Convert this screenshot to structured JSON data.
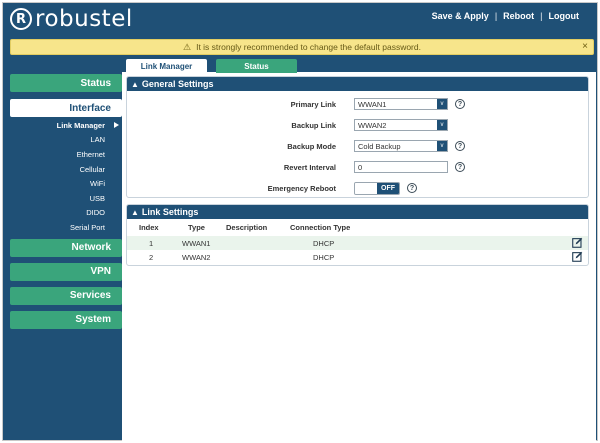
{
  "header": {
    "logo_text": "robustel",
    "logo_mark": "R",
    "links": [
      "Save & Apply",
      "Reboot",
      "Logout"
    ]
  },
  "notice": {
    "icon": "warning-icon",
    "text": "It is strongly recommended to change the default password.",
    "close": "×"
  },
  "sidebar": {
    "status": "Status",
    "interface": "Interface",
    "interface_items": [
      "Link Manager",
      "LAN",
      "Ethernet",
      "Cellular",
      "WiFi",
      "USB",
      "DIDO",
      "Serial Port"
    ],
    "network": "Network",
    "vpn": "VPN",
    "services": "Services",
    "system": "System"
  },
  "tabs": {
    "active": "Link Manager",
    "inactive": "Status"
  },
  "general": {
    "title": "General Settings",
    "primary_link_label": "Primary Link",
    "primary_link_value": "WWAN1",
    "backup_link_label": "Backup Link",
    "backup_link_value": "WWAN2",
    "backup_mode_label": "Backup Mode",
    "backup_mode_value": "Cold Backup",
    "revert_interval_label": "Revert Interval",
    "revert_interval_value": "0",
    "emergency_reboot_label": "Emergency Reboot",
    "emergency_reboot_state": "OFF",
    "arrow": "v",
    "help": "?"
  },
  "link_settings": {
    "title": "Link Settings",
    "headers": [
      "Index",
      "Type",
      "Description",
      "Connection Type"
    ],
    "rows": [
      {
        "index": "1",
        "type": "WWAN1",
        "description": "",
        "connection": "DHCP"
      },
      {
        "index": "2",
        "type": "WWAN2",
        "description": "",
        "connection": "DHCP"
      }
    ]
  },
  "colors": {
    "brand_navy": "#1f5076",
    "brand_green": "#3aa57c",
    "notice_bg": "#f7e58b",
    "row_alt": "#eaf4ec"
  }
}
